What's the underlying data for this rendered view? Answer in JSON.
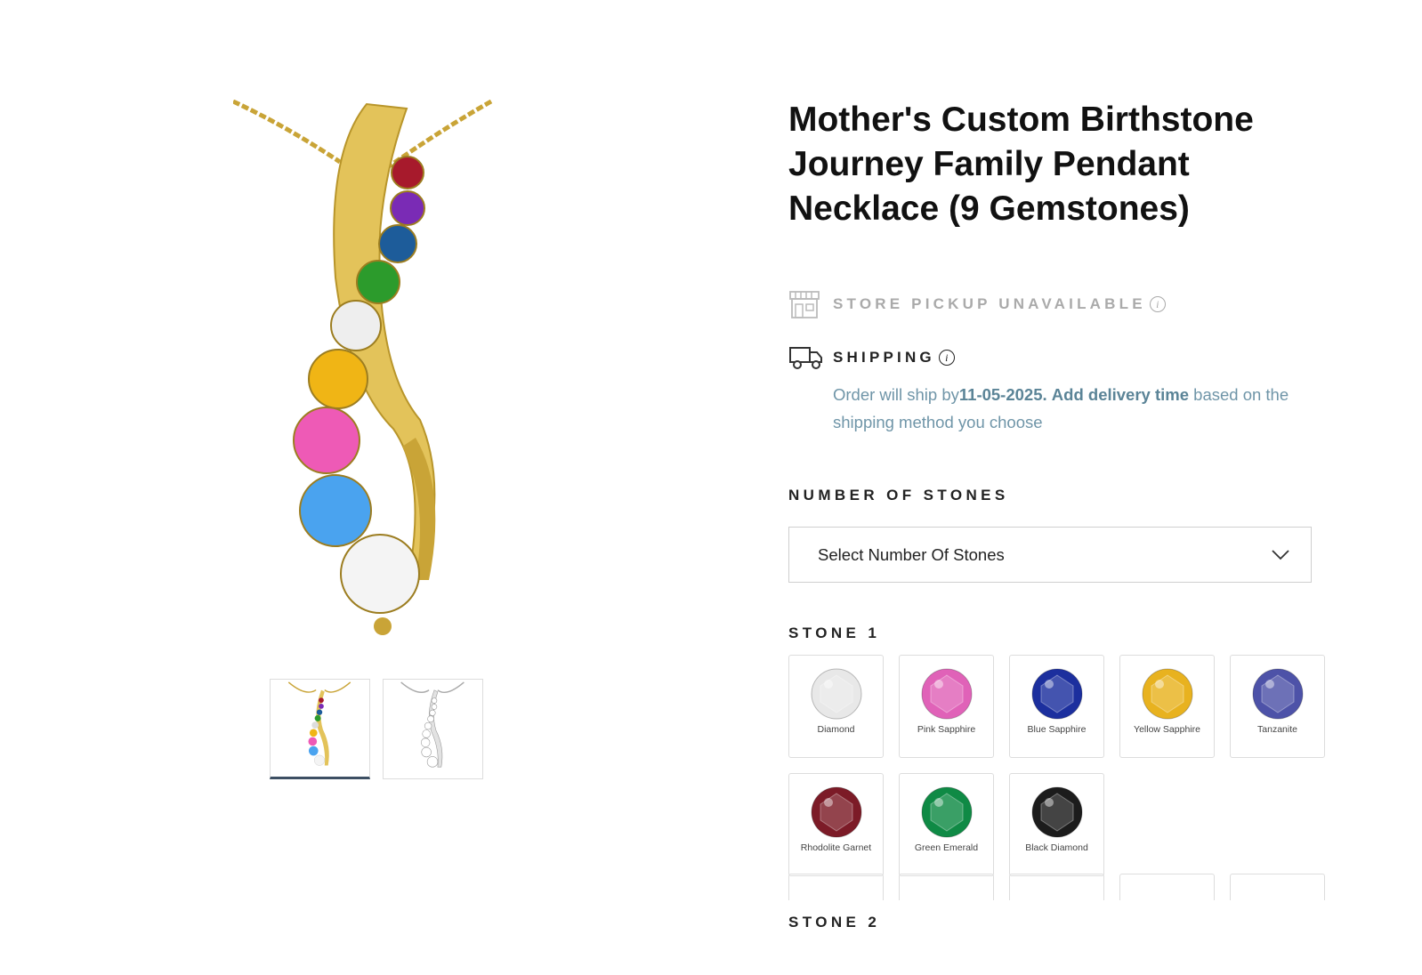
{
  "product": {
    "title": "Mother's Custom Birthstone Journey Family Pendant Necklace (9 Gemstones)"
  },
  "gallery": {
    "main_image_icon": "pendant-image",
    "thumbnails": [
      {
        "icon": "gold-pendant-thumbnail",
        "active": true
      },
      {
        "icon": "silver-pendant-thumbnail",
        "active": false
      }
    ]
  },
  "pickup": {
    "label": "STORE PICKUP UNAVAILABLE",
    "icon": "store-icon",
    "info": "i"
  },
  "shipping": {
    "label": "SHIPPING",
    "icon": "truck-icon",
    "info": "i",
    "text_prefix": "Order will ship by",
    "date": "11-05-2025.",
    "link": "Add delivery time",
    "text_suffix": "based on the shipping method you choose"
  },
  "number_of_stones": {
    "label": "NUMBER OF STONES",
    "selected": "Select Number Of Stones"
  },
  "stone1": {
    "label": "STONE 1",
    "options": [
      {
        "name": "Diamond",
        "color": "#e8e8e8"
      },
      {
        "name": "Pink Sapphire",
        "color": "#e062b8"
      },
      {
        "name": "Blue Sapphire",
        "color": "#1c2f9e"
      },
      {
        "name": "Yellow Sapphire",
        "color": "#e8b21f"
      },
      {
        "name": "Tanzanite",
        "color": "#4d52a8"
      },
      {
        "name": "Rhodolite Garnet",
        "color": "#7c1b27"
      },
      {
        "name": "Green Emerald",
        "color": "#0f8a45"
      },
      {
        "name": "Black Diamond",
        "color": "#1c1c1c"
      }
    ]
  },
  "stone2": {
    "label": "STONE 2"
  }
}
